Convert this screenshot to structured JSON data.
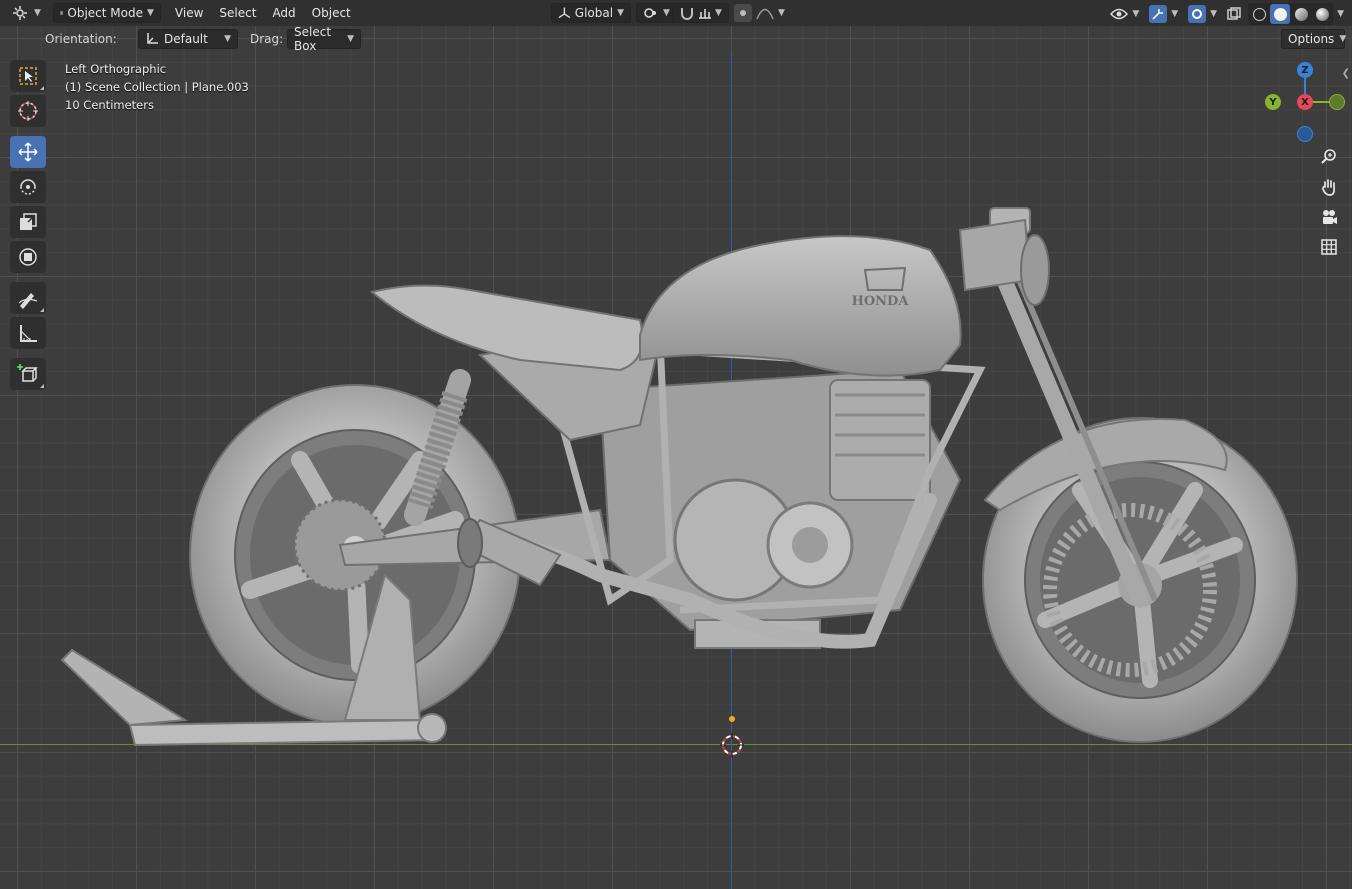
{
  "header": {
    "editor_icon": "editor-type-icon",
    "mode": "Object Mode",
    "menus": [
      "View",
      "Select",
      "Add",
      "Object"
    ],
    "transform_orientation": "Global"
  },
  "tool_settings": {
    "orientation_label": "Orientation:",
    "orientation_value": "Default",
    "drag_label": "Drag:",
    "drag_value": "Select Box",
    "options_label": "Options"
  },
  "viewport": {
    "view_name": "Left Orthographic",
    "collection": "(1) Scene Collection | Plane.003",
    "scale": "10 Centimeters",
    "model_text": "HONDA"
  },
  "gizmo": {
    "z_label": "Z",
    "y_label": "Y",
    "x_label": "X"
  },
  "toolbox": {
    "tools": [
      "select-box-icon",
      "cursor-icon",
      "move-icon",
      "rotate-icon",
      "scale-icon",
      "transform-icon",
      "annotate-icon",
      "measure-icon",
      "add-cube-icon"
    ],
    "active_tool": "move-icon"
  },
  "colors": {
    "accent": "#4772b3",
    "x_axis": "#e5495c",
    "y_axis": "#89b42d",
    "z_axis": "#3a82d8",
    "grid_bg": "#3d3d3d"
  }
}
